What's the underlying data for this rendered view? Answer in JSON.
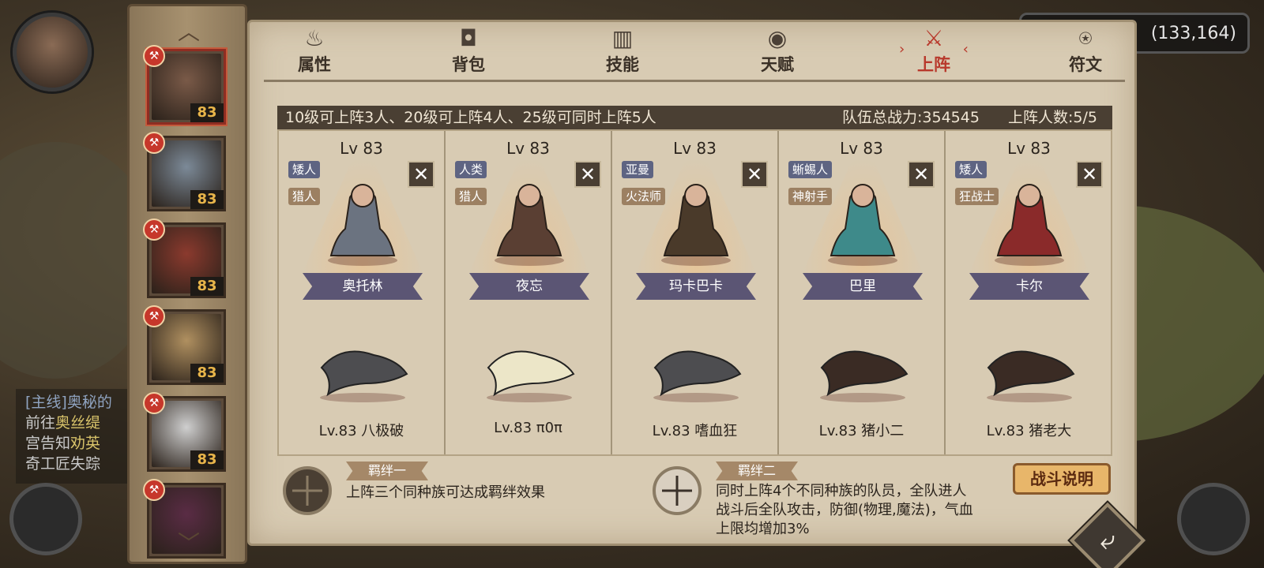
{
  "coordinates": "(133,164)",
  "quest": {
    "title": "[主线]奥秘的",
    "line1_prefix": "前往",
    "line1_highlight": "奥丝缇",
    "line2_prefix": "宫告知",
    "line2_highlight": "劝英",
    "line3": "奇工匠失踪"
  },
  "hero_list": [
    {
      "level": "83",
      "selected": true,
      "color": "#7a5a48"
    },
    {
      "level": "83",
      "selected": false,
      "color": "#7c8a98"
    },
    {
      "level": "83",
      "selected": false,
      "color": "#8b3a2e"
    },
    {
      "level": "83",
      "selected": false,
      "color": "#b09060"
    },
    {
      "level": "83",
      "selected": false,
      "color": "#cfcfcf"
    },
    {
      "level": "",
      "selected": false,
      "color": "#5a2c45"
    }
  ],
  "tabs": [
    {
      "label": "属性",
      "icon": "flame-icon",
      "glyph": "♨",
      "active": false
    },
    {
      "label": "背包",
      "icon": "bag-icon",
      "glyph": "◘",
      "active": false
    },
    {
      "label": "技能",
      "icon": "book-icon",
      "glyph": "▥",
      "active": false
    },
    {
      "label": "天赋",
      "icon": "eye-icon",
      "glyph": "◉",
      "active": false
    },
    {
      "label": "上阵",
      "icon": "crossed-swords-icon",
      "glyph": "⚔",
      "active": true
    },
    {
      "label": "符文",
      "icon": "rune-icon",
      "glyph": "⍟",
      "active": false
    }
  ],
  "info": {
    "rule": "10级可上阵3人、20级可上阵4人、25级可同时上阵5人",
    "total_power": "队伍总战力:354545",
    "member_count": "上阵人数:5/5"
  },
  "lineup": [
    {
      "level": "Lv 83",
      "race": "矮人",
      "class": "猎人",
      "name": "奥托林",
      "pet": "Lv.83 八极破",
      "hero_color": "#6b7380",
      "pet_color": "#4d4d50"
    },
    {
      "level": "Lv 83",
      "race": "人类",
      "class": "猎人",
      "name": "夜忘",
      "pet": "Lv.83 π0π",
      "hero_color": "#5a3f33",
      "pet_color": "#ece6c8"
    },
    {
      "level": "Lv 83",
      "race": "亚曼",
      "class": "火法师",
      "name": "玛卡巴卡",
      "pet": "Lv.83 嗜血狂",
      "hero_color": "#4a3a2a",
      "pet_color": "#4d4d50"
    },
    {
      "level": "Lv 83",
      "race": "蜥蜴人",
      "class": "神射手",
      "name": "巴里",
      "pet": "Lv.83 猪小二",
      "hero_color": "#3e8a8a",
      "pet_color": "#3a2b24"
    },
    {
      "level": "Lv 83",
      "race": "矮人",
      "class": "狂战士",
      "name": "卡尔",
      "pet": "Lv.83 猪老大",
      "hero_color": "#8a2a2a",
      "pet_color": "#3a2b24"
    }
  ],
  "remove_label": "✕",
  "bonds": [
    {
      "title": "羁绊一",
      "text": "上阵三个同种族可达成羁绊效果"
    },
    {
      "title": "羁绊二",
      "text_l1": "同时上阵4个不同种族的队员，全队进人",
      "text_l2": "战斗后全队攻击，防御(物理,魔法)，气血",
      "text_l3": "上限均增加3%"
    }
  ],
  "battle_button": "战斗说明",
  "back_glyph": "⤶"
}
